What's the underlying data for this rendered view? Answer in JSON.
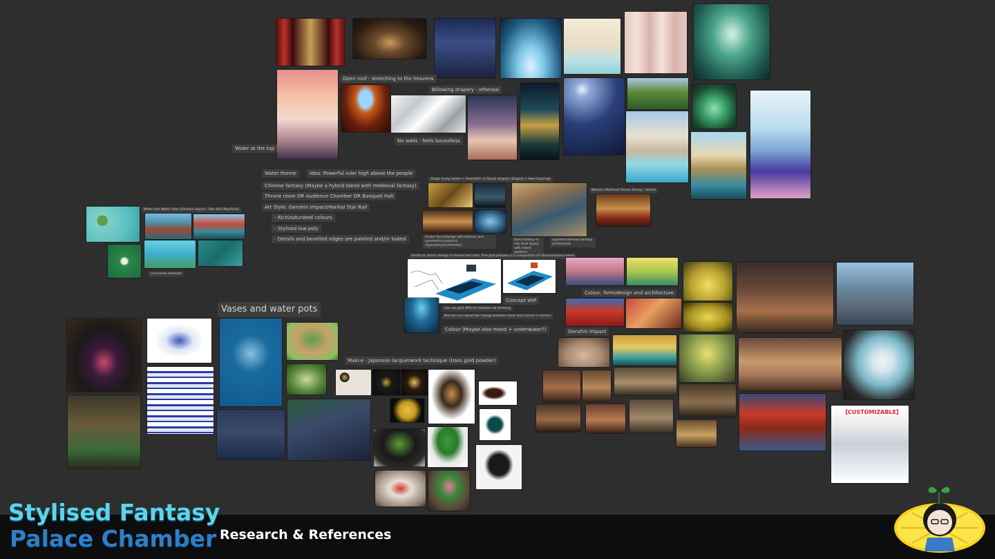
{
  "header": {
    "title_line1": "Stylised Fantasy",
    "title_line2": "Palace Chamber",
    "subtitle": "Research & References"
  },
  "notes": {
    "open_roof": "Open roof - stretching to the heavens",
    "billowing": "Billowing drapery - ethereal",
    "no_walls": "No walls - feels boundless",
    "wider_top": "Wider at the top",
    "water_theme": "Water theme",
    "idea": "Idea: Powerful ruler high above the people",
    "chinese_fantasy": "Chinese fantasy (Maybe a hybrid blend with medieval fantasy)",
    "throne_room": "Throne room OR Audience Chamber OR Banquet Hall",
    "art_style": "Art Style: Genshin Impact/Honkai Star Rail",
    "rich_colours": "- Rich/saturated colours",
    "stylised_low_poly": "- Stylised low poly",
    "details_edges": "- Details and bevelled edges are painted and/or baked",
    "shape": "Shape (Long rooms + Geometric or Round shapes) (Elegant + Awe-inspiring)",
    "western_throne": "Western Medieval Throne Dining - Hermit",
    "water_lilies": "Water and Water Lilies (Genshin impact - Star Rail (Mystical))",
    "leaf_lands": "Leaf lands (marked)",
    "concept_wip": "Concept WIP",
    "can_use_grid": "Can use grid 90% for modular set dressing",
    "not_sure": "Not too sure about the change between linear and curved + corners",
    "colour_mood": "Colour (Maybe also mood + underwater?)",
    "colour_form": "Colour, form/design and architecture",
    "genshin": "Genshin Impact",
    "vases": "Vases and water pots",
    "maki_e": "Maki-e - Japanese lacquerwork technique (Uses gold powder)",
    "shape_caption": "Centre focus/design with balcony and symmetrical balance (Symmetry/Conformity)",
    "city_caption": "Dark Fantasy vs city level layout with raised platform",
    "city_caption2": "Layered mid-level fantasy architecture",
    "concept_caption": "Similar to Saint's design in throne hall room. Fine grid pathway is a composition of interconnected rooms"
  },
  "badge": {
    "customizable": "【CUSTOMIZABLE】"
  },
  "colors": {
    "background": "#2e2e2e",
    "footer": "#0d0d0d",
    "title_light": "#5fd4e6",
    "title_dark": "#2f7fc6",
    "note_bg": "#3d3d3d"
  }
}
